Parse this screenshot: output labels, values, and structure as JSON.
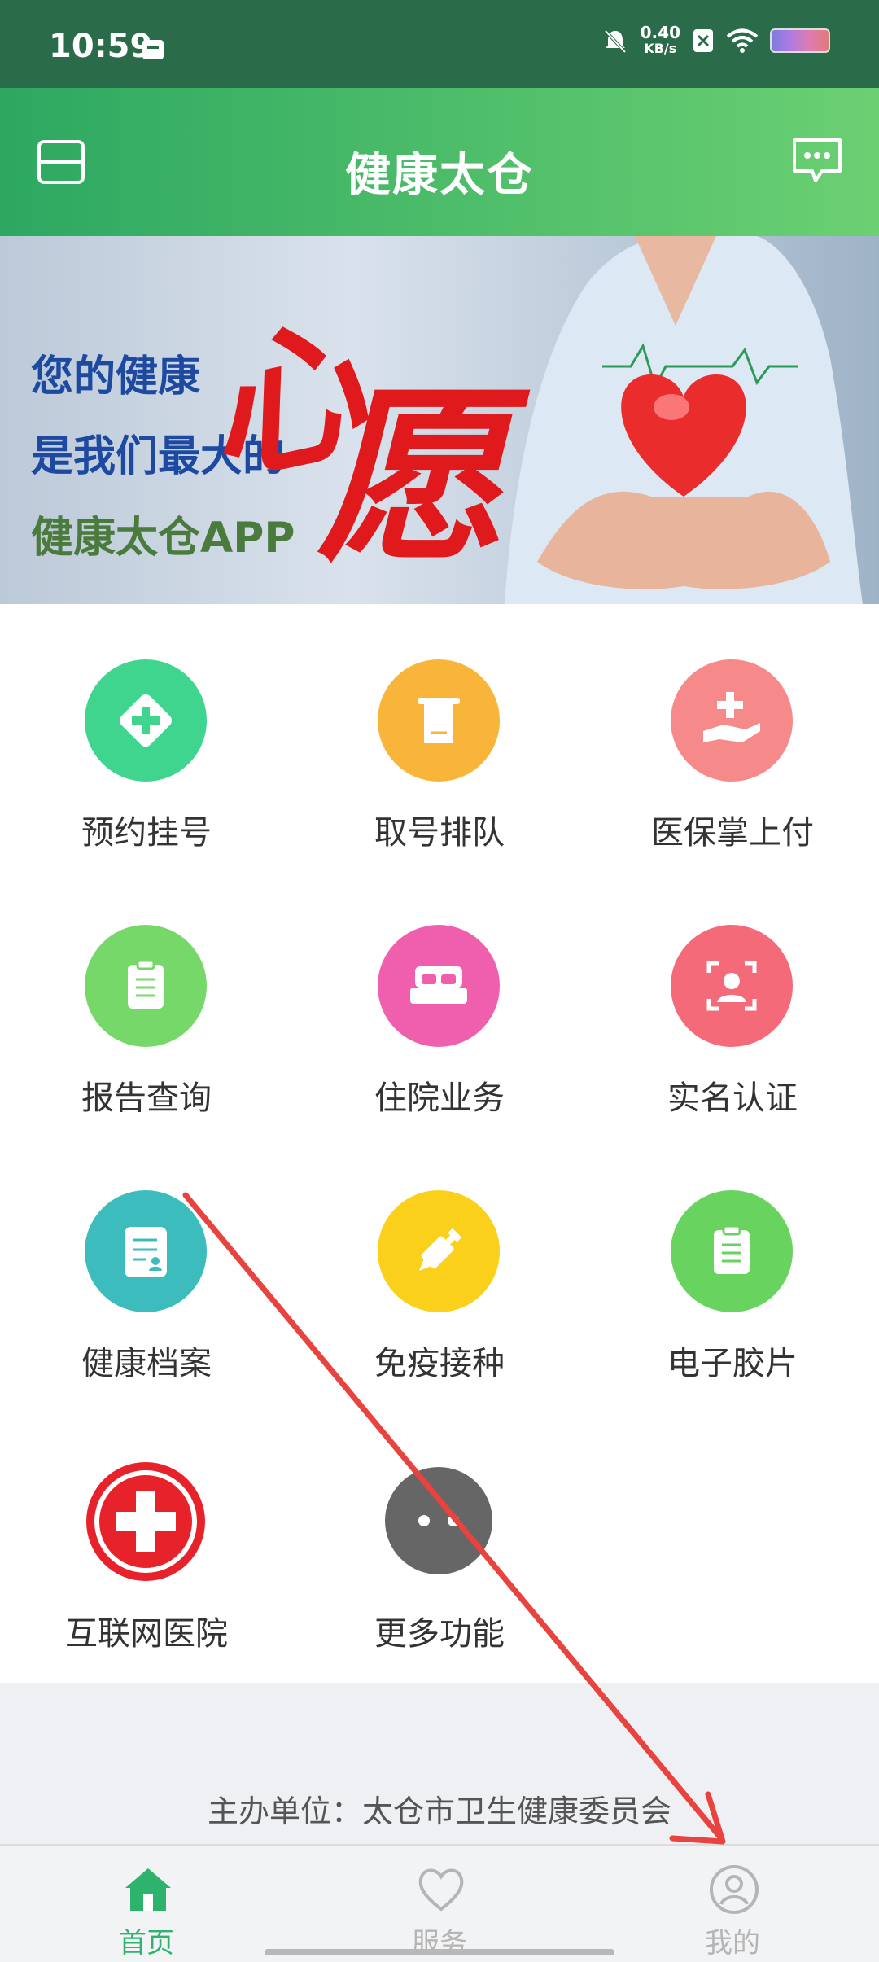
{
  "status_bar": {
    "time": "10:59",
    "speed_value": "0.40",
    "speed_unit": "KB/s"
  },
  "header": {
    "title": "健康太仓"
  },
  "banner": {
    "line1": "您的健康",
    "line2": "是我们最大的",
    "line3": "健康太仓APP",
    "calligraphy1": "心",
    "calligraphy2": "愿"
  },
  "grid": {
    "items": [
      {
        "label": "预约挂号",
        "icon": "registration-icon",
        "color": "#3fd58f"
      },
      {
        "label": "取号排队",
        "icon": "ticket-queue-icon",
        "color": "#f9b53a"
      },
      {
        "label": "医保掌上付",
        "icon": "insurance-pay-icon",
        "color": "#f68a8a"
      },
      {
        "label": "报告查询",
        "icon": "report-icon",
        "color": "#76d868"
      },
      {
        "label": "住院业务",
        "icon": "hospital-bed-icon",
        "color": "#f05fae"
      },
      {
        "label": "实名认证",
        "icon": "real-name-icon",
        "color": "#f56a78"
      },
      {
        "label": "健康档案",
        "icon": "health-record-icon",
        "color": "#3cbcbc"
      },
      {
        "label": "免疫接种",
        "icon": "vaccine-icon",
        "color": "#fbd01a"
      },
      {
        "label": "电子胶片",
        "icon": "e-film-icon",
        "color": "#68d35e"
      },
      {
        "label": "互联网医院",
        "icon": "internet-hospital-icon",
        "color": "#e8222b"
      },
      {
        "label": "更多功能",
        "icon": "more-icon",
        "color": "#666666"
      }
    ]
  },
  "footer": {
    "sponsor": "主办单位：太仓市卫生健康委员会"
  },
  "tabbar": {
    "tabs": [
      {
        "label": "首页",
        "active": true
      },
      {
        "label": "服务",
        "active": false
      },
      {
        "label": "我的",
        "active": false
      }
    ],
    "active_color": "#2db36b",
    "inactive_color": "#b5b5b5"
  }
}
